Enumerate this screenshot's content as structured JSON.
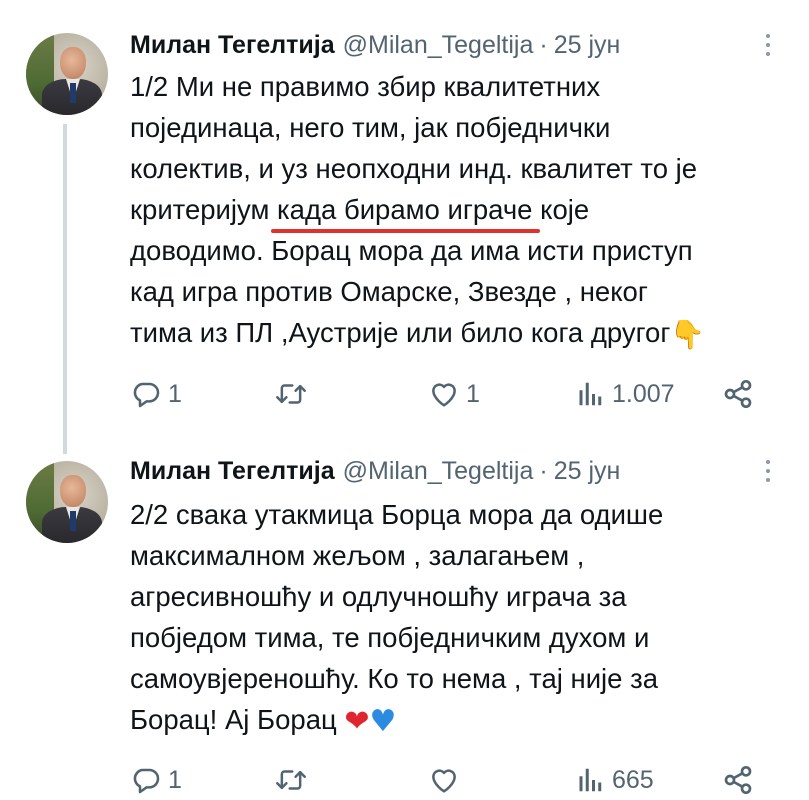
{
  "tweets": [
    {
      "author_name": "Милан Тегелтија",
      "handle": "@Milan_Tegeltija",
      "separator": "·",
      "date": "25 јун",
      "lines": [
        "1/2 Ми не правимо збир квалитетних",
        "појединаца, него тим, јак побједнички",
        "колектив, и уз неопходни инд. квалитет то је"
      ],
      "line4_before": "критеријум ",
      "line4_highlight": "када бирамо играче",
      "line4_after": " које",
      "lines_after": [
        "доводимо. Борац мора да има исти приступ",
        "кад игра против Омарске,  Звезде , неког"
      ],
      "last_line": "тима из ПЛ ,Аустрије или било кога другог",
      "emoji_hand": "👇",
      "replies": "1",
      "retweets": "",
      "likes": "1",
      "views": "1.007"
    },
    {
      "author_name": "Милан Тегелтија",
      "handle": "@Milan_Tegeltija",
      "separator": "·",
      "date": "25 јун",
      "lines": [
        "2/2 свака утакмица Борца мора да одише",
        "максималном жељом , залагањем ,",
        "агресивношћу и одлучношћу играча за",
        "побједом тима, те побједничким духом и",
        "самоувјереношћу. Ко то нема , тај није за"
      ],
      "last_line": "Борац! Ај Борац ",
      "emoji_red_heart": "❤",
      "emoji_blue_heart": "♥",
      "replies": "1",
      "retweets": "",
      "likes": "",
      "views": "665"
    }
  ],
  "colors": {
    "text": "#0f1419",
    "secondary": "#536471",
    "thread_line": "#cfd9de",
    "highlight_underline": "#e0322d"
  },
  "icons": [
    "reply-icon",
    "retweet-icon",
    "like-icon",
    "views-icon",
    "share-icon",
    "more-icon"
  ]
}
